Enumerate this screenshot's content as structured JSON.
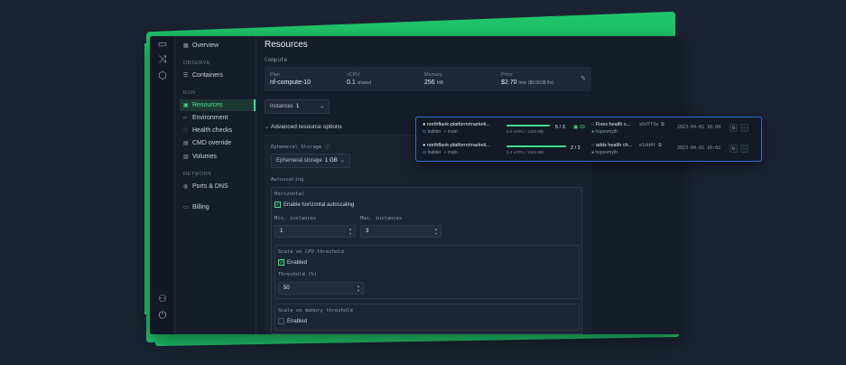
{
  "nav": {
    "overview": "Overview",
    "sec_observe": "OBSERVE",
    "containers": "Containers",
    "sec_run": "RUN",
    "resources": "Resources",
    "environment": "Environment",
    "health_checks": "Health checks",
    "cmd_override": "CMD override",
    "volumes": "Volumes",
    "sec_network": "NETWORK",
    "ports_dns": "Ports & DNS",
    "billing": "Billing"
  },
  "main": {
    "title": "Resources",
    "compute_label": "Compute",
    "plan": {
      "k": "Plan",
      "v": "nf-compute-10"
    },
    "vcpu": {
      "k": "vCPU",
      "v": "0.1",
      "unit": "shared"
    },
    "memory": {
      "k": "Memory",
      "v": "256",
      "unit": "MB"
    },
    "price": {
      "k": "Price",
      "v": "$2.70",
      "unit": "/mo",
      "hourly": "($0.0038 /hr)"
    },
    "instances_label": "Instances",
    "instances_value": "1",
    "advanced_label": "Advanced resource options",
    "ephemeral_label": "Ephemeral Storage",
    "ephemeral_select_label": "Ephemeral storage",
    "ephemeral_value": "1 GB",
    "autoscaling_label": "Autoscaling",
    "horizontal_label": "Horizontal",
    "enable_horizontal": "Enable horizontal autoscaling",
    "min_label": "Min. instances",
    "min_value": "1",
    "max_label": "Max. instances",
    "max_value": "3",
    "cpu_threshold_label": "Scale on CPU threshold",
    "cpu_enabled": "Enabled",
    "threshold_label": "Threshold (%)",
    "threshold_value": "50",
    "mem_threshold_label": "Scale on memory threshold",
    "mem_enabled": "Enabled"
  },
  "popup": {
    "rows": [
      {
        "repo": "northflank-platform/marketi...",
        "builder": "builder",
        "branch": "main",
        "resources": "0.5 vCPU / 1280 MB",
        "progress": 1.0,
        "count": "5 / 3",
        "badge": "19",
        "commit": "Fixes health c...",
        "hash": "a5d7f3a",
        "author": "hopesmyth",
        "date": "2023-04-01 16:08"
      },
      {
        "repo": "northflank-platform/marketi...",
        "builder": "builder",
        "branch": "main",
        "resources": "0.4 vCPU / 1024 MB",
        "progress": 1.0,
        "count": "2 / 2",
        "badge": "",
        "commit": "adds health ch...",
        "hash": "e1dd4f",
        "author": "hopesmyth",
        "date": "2023-04-01 16:02"
      }
    ]
  },
  "colors": {
    "accent": "#3fe08a",
    "frame": "#1fc46a",
    "popup_border": "#2f6fd4"
  },
  "icons": [
    "calendar-icon",
    "shuffle-icon",
    "network-icon",
    "users-icon",
    "logout-icon",
    "github-icon",
    "pencil-icon"
  ]
}
